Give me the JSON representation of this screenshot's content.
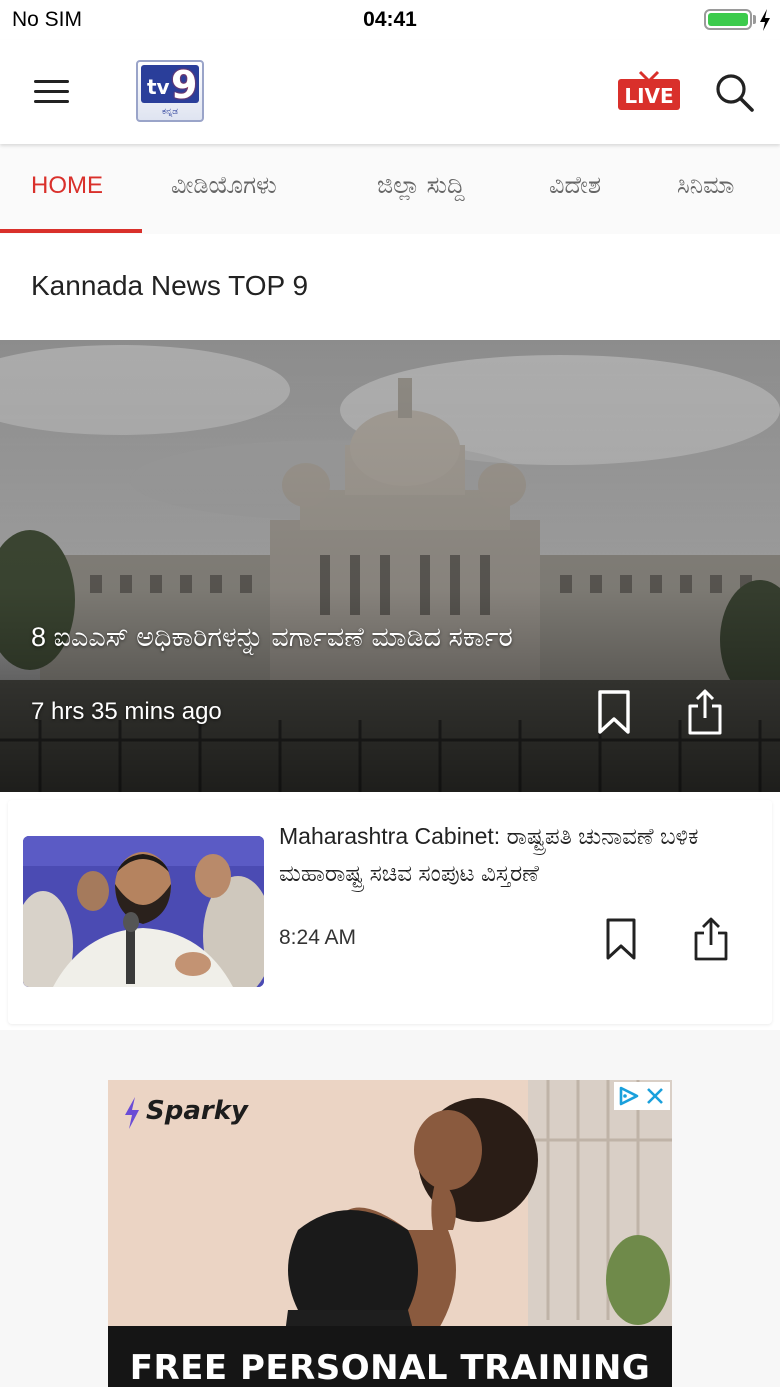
{
  "status_bar": {
    "carrier": "No SIM",
    "time": "04:41",
    "battery_level": 1.0,
    "battery_color": "#3ccb4c"
  },
  "header": {
    "logo_text": "tv9",
    "logo_subtext": "ಕನ್ನಡ",
    "live_label": "LIVE",
    "icons": [
      "menu-icon",
      "live-tv-icon",
      "search-icon"
    ],
    "accent_color": "#d9302b"
  },
  "tabs": [
    {
      "label": "HOME",
      "active": true
    },
    {
      "label": "ವೀಡಿಯೊಗಳು",
      "active": false
    },
    {
      "label": "ಜಿಲ್ಲಾ ಸುದ್ದಿ",
      "active": false
    },
    {
      "label": "ವಿದೇಶ",
      "active": false
    },
    {
      "label": "ಸಿನಿಮಾ",
      "active": false
    }
  ],
  "section_title": "Kannada News TOP 9",
  "hero": {
    "title": "8 ಐಎಎಸ್ ಅಧಿಕಾರಿಗಳನ್ನು ವರ್ಗಾವಣೆ ಮಾಡಿದ ಸರ್ಕಾರ",
    "time": "7 hrs 35 mins ago",
    "actions": [
      "bookmark-icon",
      "share-icon"
    ]
  },
  "articles": [
    {
      "title": "Maharashtra Cabinet: ರಾಷ್ಟ್ರಪತಿ ಚುನಾವಣೆ ಬಳಿಕ ಮಹಾರಾಷ್ಟ್ರ ಸಚಿವ ಸಂಪುಟ ವಿಸ್ತರಣೆ",
      "time": "8:24 AM",
      "actions": [
        "bookmark-icon",
        "share-icon"
      ]
    }
  ],
  "ad": {
    "brand": "Sparky",
    "cta": "FREE PERSONAL TRAINING",
    "icons": [
      "adchoices-icon",
      "close-icon"
    ]
  }
}
